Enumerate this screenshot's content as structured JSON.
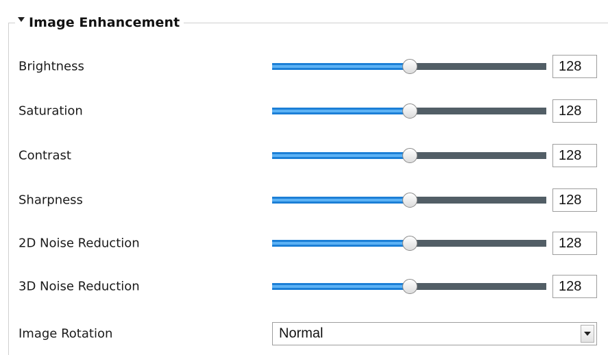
{
  "section": {
    "title": "Image Enhancement",
    "collapse_icon": "triangle-down-icon"
  },
  "colors": {
    "slider_fill": "#1c7fd6",
    "slider_track": "#525e66"
  },
  "settings": [
    {
      "label": "Brightness",
      "value": "128",
      "level": 128,
      "max": 255
    },
    {
      "label": "Saturation",
      "value": "128",
      "level": 128,
      "max": 255
    },
    {
      "label": "Contrast",
      "value": "128",
      "level": 128,
      "max": 255
    },
    {
      "label": "Sharpness",
      "value": "128",
      "level": 128,
      "max": 255
    },
    {
      "label": "2D Noise Reduction",
      "value": "128",
      "level": 128,
      "max": 255
    },
    {
      "label": "3D Noise Reduction",
      "value": "128",
      "level": 128,
      "max": 255
    }
  ],
  "rotation": {
    "label": "Image Rotation",
    "selected": "Normal",
    "dropdown_icon": "chevron-down-icon"
  }
}
